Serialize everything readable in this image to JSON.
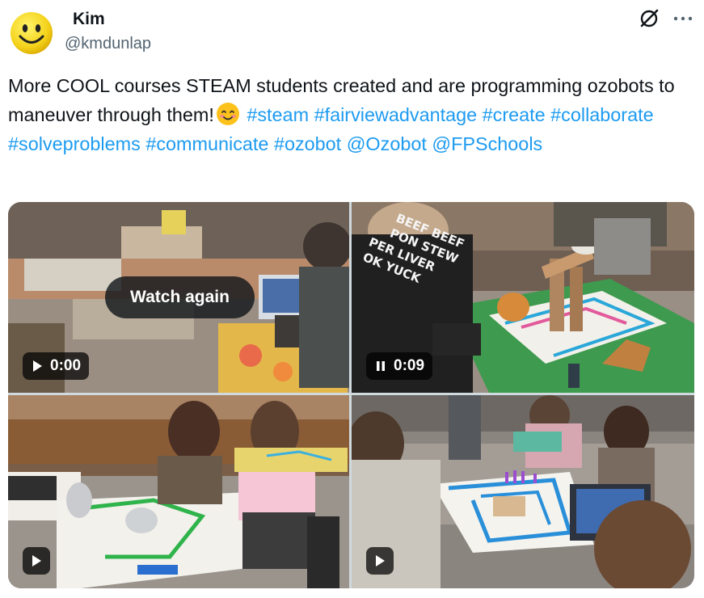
{
  "author": {
    "display_name": "Kim",
    "handle": "@kmdunlap",
    "avatar_icon": "smiley-face-avatar"
  },
  "header_icons": {
    "grok": "grok-icon",
    "more": "more-dots-icon"
  },
  "tweet": {
    "text_intro": "More COOL courses STEAM students created and are programming ozobots to maneuver through them!",
    "emoji": "smiling-face-emoji",
    "hashtags": [
      "#steam",
      "#fairviewadvantage",
      "#create",
      "#collaborate",
      "#solveproblems",
      "#communicate",
      "#ozobot"
    ],
    "mentions": [
      "@Ozobot",
      "@FPSchools"
    ]
  },
  "media": {
    "watch_again_label": "Watch again",
    "video1": {
      "time": "0:00",
      "state": "play-icon"
    },
    "video2": {
      "time": "0:09",
      "state": "pause-icon"
    },
    "video3": {
      "state": "play-icon"
    },
    "video4": {
      "state": "play-icon"
    },
    "shirt_text": [
      "BEEF BEEF",
      "PON STEW",
      "PER LIVER",
      "OK YUCK"
    ]
  },
  "colors": {
    "link": "#1d9bf0",
    "text": "#0f1419",
    "secondary": "#536471"
  }
}
